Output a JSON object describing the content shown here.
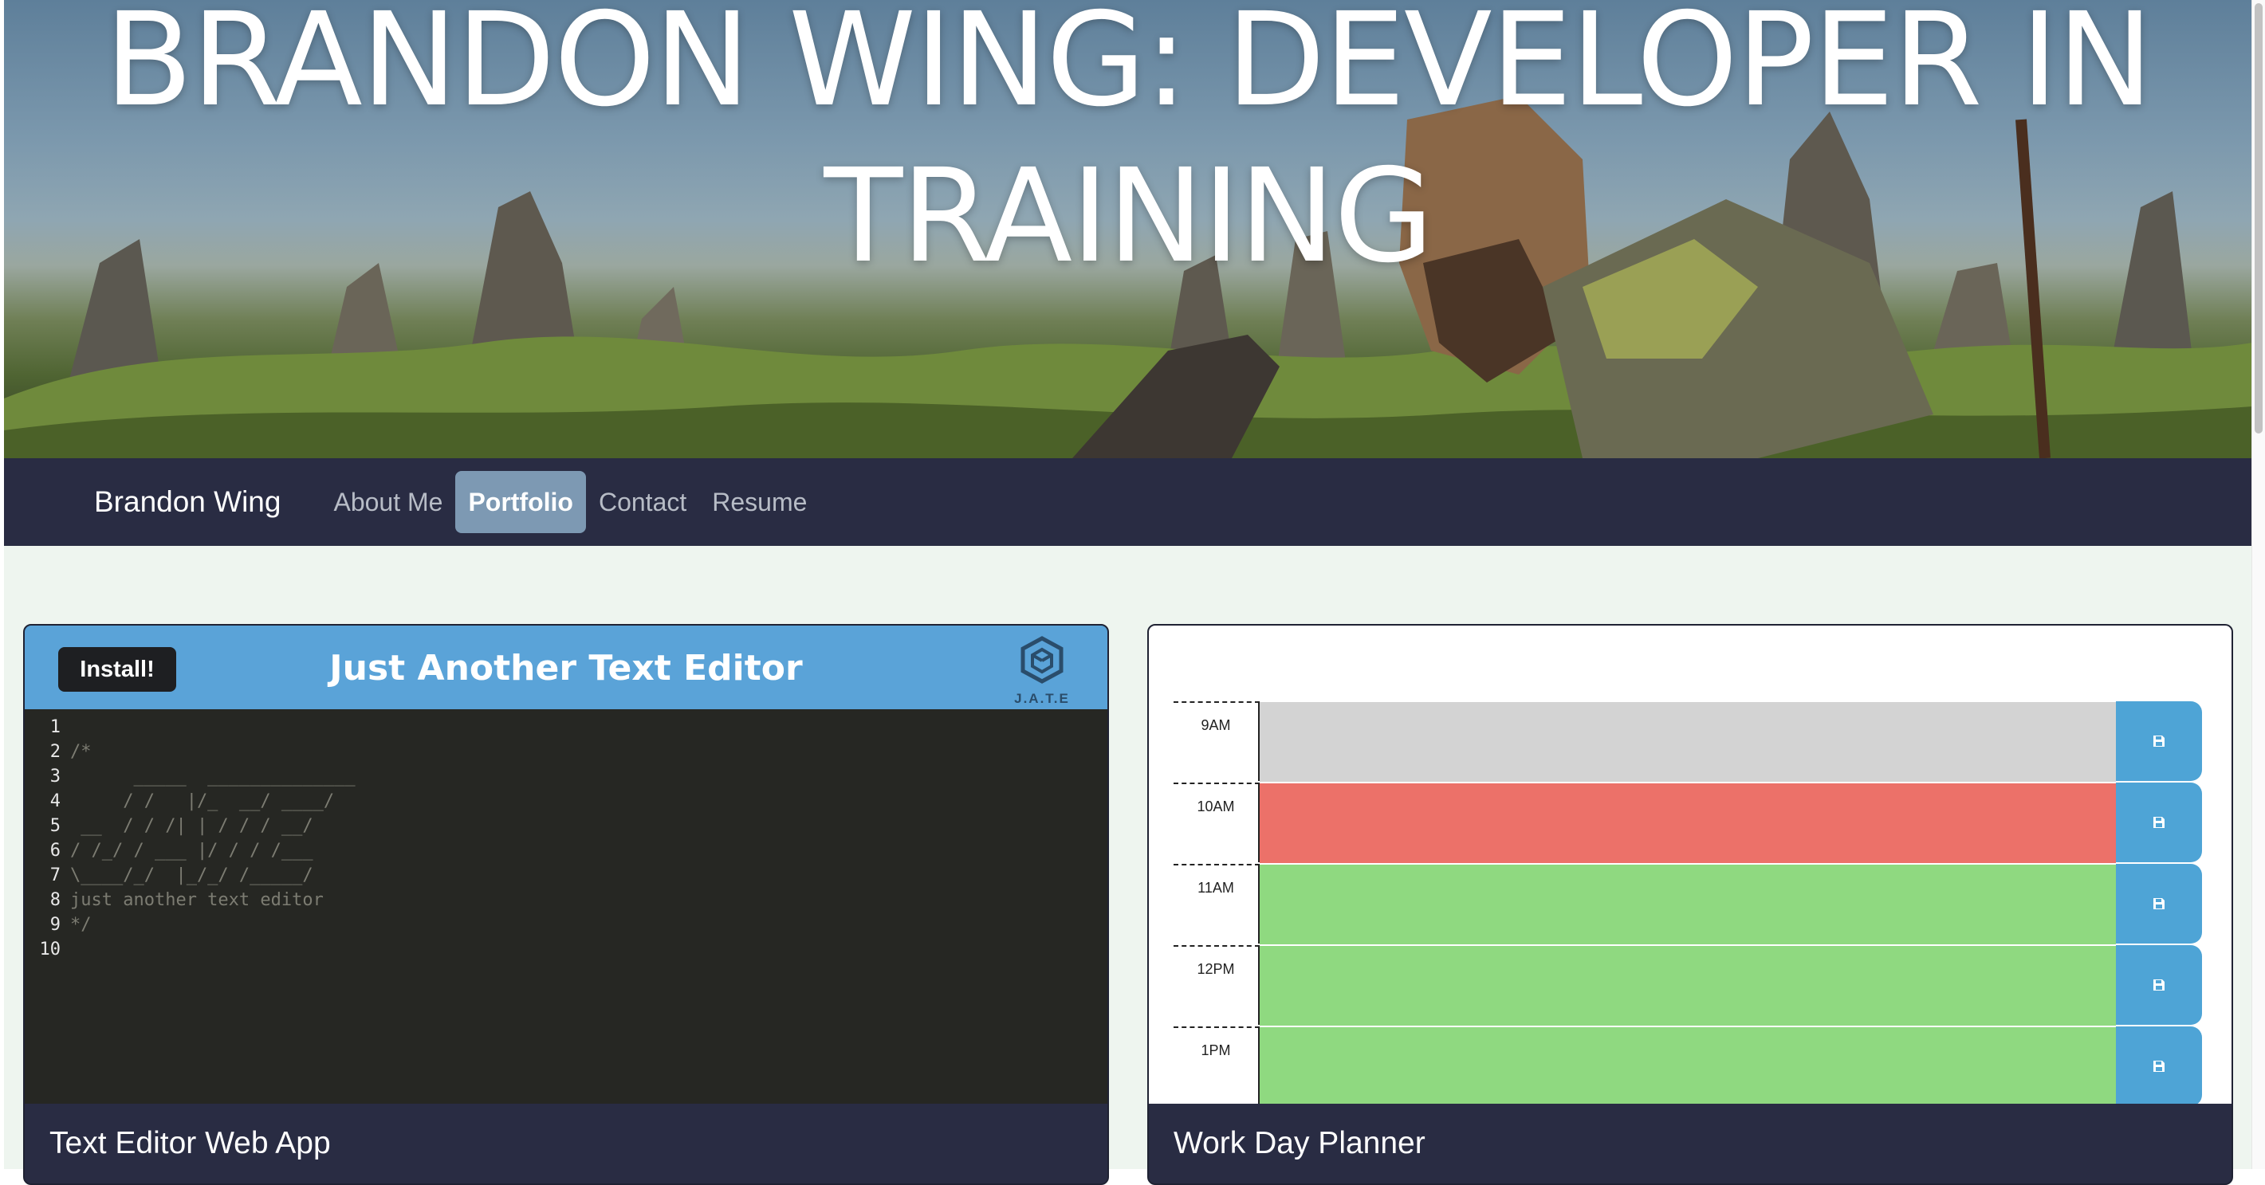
{
  "hero": {
    "title_line1": "BRANDON WING: DEVELOPER IN",
    "title_line2": "TRAINING"
  },
  "navbar": {
    "brand": "Brandon Wing",
    "links": [
      {
        "label": "About Me",
        "active": false
      },
      {
        "label": "Portfolio",
        "active": true
      },
      {
        "label": "Contact",
        "active": false
      },
      {
        "label": "Resume",
        "active": false
      }
    ]
  },
  "projects": [
    {
      "caption": "Text Editor Web App",
      "preview": {
        "install_label": "Install!",
        "app_title": "Just Another Text Editor",
        "logo_text": "J.A.T.E",
        "logo_icon": "jate-cube-icon",
        "line_numbers": [
          "1",
          "2",
          "3",
          "4",
          "5",
          "6",
          "7",
          "8",
          "9",
          "10"
        ],
        "code_lines": [
          "",
          "/*",
          "      _____  ______________",
          "     / /   |/_  __/ ____/",
          " __  / / /| | / / / __/",
          "/ /_/ / ___ |/ / / /___",
          "\\____/_/  |_/_/ /_____/",
          "just another text editor",
          "*/",
          ""
        ]
      }
    },
    {
      "caption": "Work Day Planner",
      "preview": {
        "rows": [
          {
            "hour": "9AM",
            "state": "past"
          },
          {
            "hour": "10AM",
            "state": "present"
          },
          {
            "hour": "11AM",
            "state": "future"
          },
          {
            "hour": "12PM",
            "state": "future"
          },
          {
            "hour": "1PM",
            "state": "future"
          }
        ],
        "save_icon": "floppy-disk-icon"
      }
    }
  ],
  "colors": {
    "navbar_bg": "#292c43",
    "active_link_bg": "#7d99b3",
    "content_bg": "#eef5ef",
    "jate_header": "#5aa3d8",
    "past": "#d3d3d3",
    "present": "#ec7169",
    "future": "#8fd980",
    "save_button": "#4ea4d6"
  }
}
